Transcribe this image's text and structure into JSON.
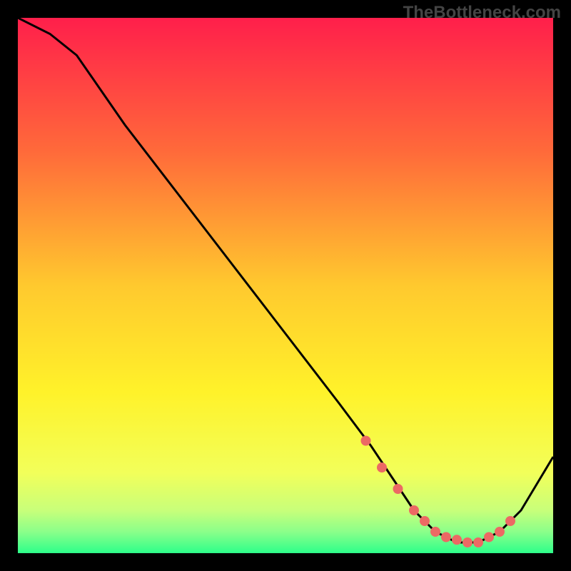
{
  "watermark": "TheBottleneck.com",
  "chart_data": {
    "type": "line",
    "title": "",
    "xlabel": "",
    "ylabel": "",
    "xlim": [
      0,
      100
    ],
    "ylim": [
      0,
      100
    ],
    "grid": false,
    "legend": false,
    "series": [
      {
        "name": "curve",
        "x": [
          0,
          6,
          11,
          20,
          30,
          40,
          50,
          60,
          66,
          70,
          74,
          78,
          82,
          86,
          90,
          94,
          100
        ],
        "y": [
          100,
          97,
          93,
          80,
          67,
          54,
          41,
          28,
          20,
          14,
          8,
          4,
          2,
          2,
          4,
          8,
          18
        ]
      }
    ],
    "markers": {
      "name": "highlight-points",
      "x": [
        65,
        68,
        71,
        74,
        76,
        78,
        80,
        82,
        84,
        86,
        88,
        90,
        92
      ],
      "y": [
        21,
        16,
        12,
        8,
        6,
        4,
        3,
        2.5,
        2,
        2,
        3,
        4,
        6
      ]
    },
    "gradient_stops": [
      {
        "offset": 0.0,
        "color": "#ff1f4b"
      },
      {
        "offset": 0.25,
        "color": "#ff6a3a"
      },
      {
        "offset": 0.5,
        "color": "#ffc92e"
      },
      {
        "offset": 0.7,
        "color": "#fff22a"
      },
      {
        "offset": 0.85,
        "color": "#f2ff5a"
      },
      {
        "offset": 0.92,
        "color": "#c8ff7a"
      },
      {
        "offset": 0.96,
        "color": "#8bff8a"
      },
      {
        "offset": 1.0,
        "color": "#2dff8a"
      }
    ]
  }
}
